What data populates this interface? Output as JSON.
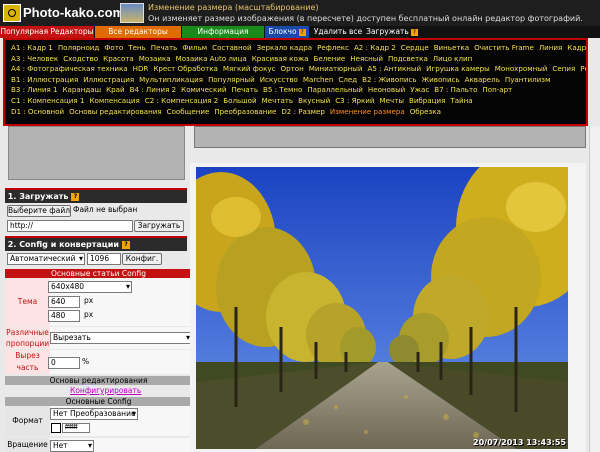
{
  "header": {
    "site_title": "Photo-kako.com",
    "line1": "Изменение размера (масштабирование)",
    "line2": "Он изменяет размер изображения (в пересчете) доступен бесплатный онлайн редактор фотографий."
  },
  "tabs": [
    {
      "label": "Популярная Редакторы",
      "color": "#c41212"
    },
    {
      "label": "Все редакторы",
      "color": "#e06b00"
    },
    {
      "label": "Информация",
      "color": "#1a8a1a"
    },
    {
      "label": "Блокчо",
      "color": "#1a4aa8"
    },
    {
      "label": "Удалить все",
      "color": "#2b2b2b"
    },
    {
      "label": "Загружать",
      "color": "#2b2b2b"
    }
  ],
  "menu": {
    "rows": [
      [
        "A1 : Кадр 1",
        "Полярноид",
        "Фото",
        "Тень",
        "Печать",
        "Фильм",
        "Составной",
        "Зеркало кадра",
        "Рефлекс",
        "A2 : Кадр 2",
        "Сердце",
        "Виньетка",
        "Очистить Frame",
        "Линия",
        "Кадр"
      ],
      [
        "A3 : Человек",
        "Сходство",
        "Красота",
        "Мозаика",
        "Мозаика Auto лица",
        "Красивая кожа",
        "Беление",
        "Неясный",
        "Подсветка",
        "Лицо клип"
      ],
      [
        "A4 : Фотографическая техника",
        "HDR",
        "Крест Обработка",
        "Мягкий фокус",
        "Ортон",
        "Миниатюрный",
        "A5 : Антикный",
        "Игрушка камеры",
        "Монохромный",
        "Сепия",
        "Ретро"
      ],
      [
        "B1 : Иллюстрация",
        "Иллюстрация",
        "Мультипликация",
        "Популярный",
        "Искусство",
        "Marchen",
        "След",
        "B2 : Живопись",
        "Живопись",
        "Акварель",
        "Пуантилизм"
      ],
      [
        "B3 : Линия 1",
        "Карандаш",
        "Край",
        "B4 : Линия 2",
        "Комический",
        "Печать",
        "B5 : Темно",
        "Параллельный",
        "Неоновый",
        "Ужас",
        "B7 : Пальто",
        "Поп-арт"
      ],
      [
        "C1 : Компенсация 1",
        "Компенсация",
        "C2 : Компенсация 2",
        "Большой",
        "Мечтать",
        "Вкусный",
        "C3 : Яркий",
        "Мечты",
        "Вибрация",
        "Тайна"
      ],
      [
        "D1 : Основной",
        "Основы редактирования",
        "Сообщение",
        "Преобразование",
        "D2 : Размер",
        "Изменение размера",
        "Обрезка"
      ]
    ],
    "highlight": "Изменение размера"
  },
  "upload": {
    "heading": "1. Загружать",
    "choose_file": "Выберите файл",
    "no_file": "Файл не выбран",
    "url_value": "http://",
    "upload_button": "Загружать"
  },
  "config": {
    "heading": "2. Config и конвертации",
    "mode": "Автоматический",
    "quality": "1096",
    "config_button": "Конфиг."
  },
  "settings": {
    "section_title": "Основные статьи Config",
    "theme_label": "Тема",
    "size_option": "640x480",
    "width": "640",
    "height": "480",
    "unit": "px",
    "ratio_label": "Различные пропорции",
    "ratio_option": "Вырезать",
    "cut_label": "Вырез часть",
    "cut_value": "0",
    "cut_unit": "%",
    "edit_basics": "Основы редактирования",
    "configure_link": "Конфигурировать",
    "basic_config": "Основные Config",
    "format_label": "Формат",
    "format_option": "Нет Преобразование",
    "color_value": "ffffff",
    "rotation_label": "Вращение",
    "rotation_option": "Нет"
  },
  "photo": {
    "timestamp": "20/07/2013 13:43:55"
  },
  "icons": {
    "help": "help-icon",
    "logo": "camera-logo-icon"
  }
}
